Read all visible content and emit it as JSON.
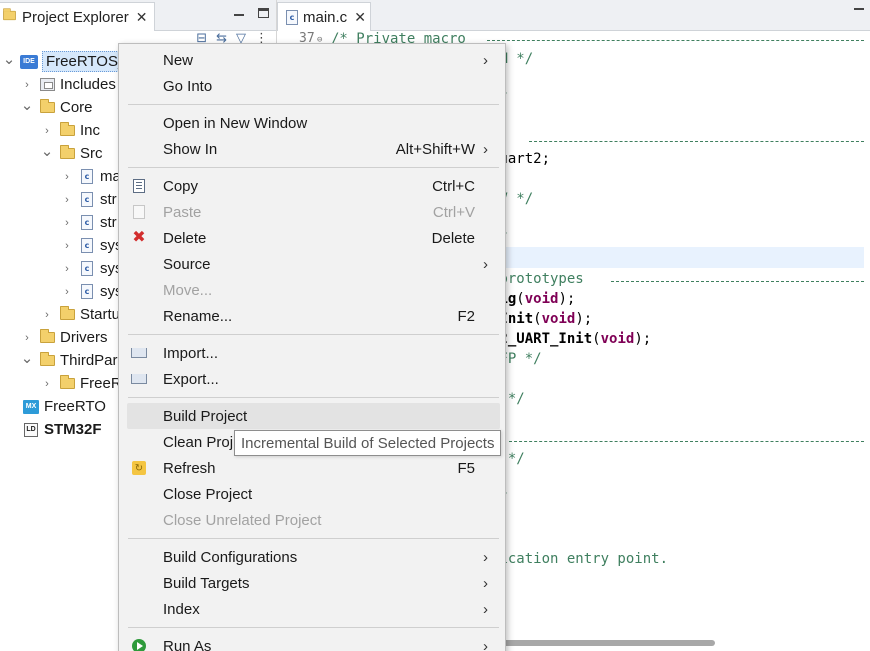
{
  "explorer": {
    "tab_title": "Project Explorer",
    "tree": [
      {
        "label": "FreeRTOS_F",
        "icon": "ide-project-icon",
        "expanded": true
      },
      {
        "label": "Includes",
        "icon": "includes-icon",
        "expanded": false
      },
      {
        "label": "Core",
        "icon": "folder-icon",
        "expanded": true
      },
      {
        "label": "Inc",
        "icon": "folder-icon",
        "expanded": false
      },
      {
        "label": "Src",
        "icon": "folder-icon",
        "expanded": true
      },
      {
        "label": "ma",
        "icon": "c-file-icon"
      },
      {
        "label": "str",
        "icon": "c-file-icon"
      },
      {
        "label": "str",
        "icon": "c-file-icon"
      },
      {
        "label": "sys",
        "icon": "c-file-icon"
      },
      {
        "label": "sys",
        "icon": "c-file-icon"
      },
      {
        "label": "sys",
        "icon": "c-file-icon"
      },
      {
        "label": "Startu",
        "icon": "folder-icon",
        "expanded": false
      },
      {
        "label": "Drivers",
        "icon": "folder-icon",
        "expanded": false
      },
      {
        "label": "ThirdPar",
        "icon": "folder-icon",
        "expanded": true
      },
      {
        "label": "FreeR",
        "icon": "folder-icon",
        "expanded": false
      },
      {
        "label": "FreeRTO",
        "icon": "mx-file-icon"
      },
      {
        "label": "STM32F",
        "icon": "ld-file-icon"
      }
    ]
  },
  "editor": {
    "tab_title": "main.c",
    "line_number": "37",
    "lines": [
      {
        "parts": [
          {
            "t": "/* Private macro ",
            "c": "comment"
          }
        ]
      },
      {
        "parts": [
          {
            "t": "PM */",
            "c": "comment"
          }
        ]
      },
      {
        "parts": [
          {
            "t": "",
            "c": "plain"
          }
        ]
      },
      {
        "parts": [
          {
            "t": "*/",
            "c": "comment"
          }
        ]
      },
      {
        "parts": [
          {
            "t": "",
            "c": "plain"
          }
        ]
      },
      {
        "parts": [
          {
            "t": "s ",
            "c": "comment"
          }
        ]
      },
      {
        "parts": [
          {
            "t": "huart2;",
            "c": "plain"
          }
        ]
      },
      {
        "parts": [
          {
            "t": "",
            "c": "plain"
          }
        ]
      },
      {
        "parts": [
          {
            "t": "PV */",
            "c": "comment"
          }
        ]
      },
      {
        "parts": [
          {
            "t": "",
            "c": "plain"
          }
        ]
      },
      {
        "parts": [
          {
            "t": "*/",
            "c": "comment"
          }
        ]
      },
      {
        "parts": [
          {
            "t": "",
            "c": "plain"
          }
        ]
      },
      {
        "parts": [
          {
            "t": " prototypes ",
            "c": "comment"
          }
        ]
      },
      {
        "parts": [
          {
            "t": "fig",
            "c": "fn"
          },
          {
            "t": "(",
            "c": "plain"
          },
          {
            "t": "void",
            "c": "kw"
          },
          {
            "t": ");",
            "c": "plain"
          }
        ]
      },
      {
        "parts": [
          {
            "t": "_Init",
            "c": "fn"
          },
          {
            "t": "(",
            "c": "plain"
          },
          {
            "t": "void",
            "c": "kw"
          },
          {
            "t": ");",
            "c": "plain"
          }
        ]
      },
      {
        "parts": [
          {
            "t": "T2_UART_Init",
            "c": "fn"
          },
          {
            "t": "(",
            "c": "plain"
          },
          {
            "t": "void",
            "c": "kw"
          },
          {
            "t": ");",
            "c": "plain"
          }
        ]
      },
      {
        "parts": [
          {
            "t": "PFP */",
            "c": "comment"
          }
        ]
      },
      {
        "parts": [
          {
            "t": "",
            "c": "plain"
          }
        ]
      },
      {
        "parts": [
          {
            "t": "P */",
            "c": "comment"
          }
        ]
      },
      {
        "parts": [
          {
            "t": "",
            "c": "plain"
          }
        ]
      },
      {
        "parts": [
          {
            "t": "",
            "c": "plain"
          }
        ]
      },
      {
        "parts": [
          {
            "t": "0 */",
            "c": "comment"
          }
        ]
      },
      {
        "parts": [
          {
            "t": "",
            "c": "plain"
          }
        ]
      },
      {
        "parts": [
          {
            "t": "*/",
            "c": "comment"
          }
        ]
      },
      {
        "parts": [
          {
            "t": "",
            "c": "plain"
          }
        ]
      },
      {
        "parts": [
          {
            "t": "",
            "c": "plain"
          }
        ]
      },
      {
        "parts": [
          {
            "t": "lication entry point.",
            "c": "comment"
          }
        ]
      }
    ]
  },
  "menu": {
    "items": [
      {
        "label": "New",
        "submenu": true
      },
      {
        "label": "Go Into"
      },
      {
        "sep": true
      },
      {
        "label": "Open in New Window"
      },
      {
        "label": "Show In",
        "accel": "Alt+Shift+W",
        "submenu": true
      },
      {
        "sep": true
      },
      {
        "label": "Copy",
        "accel": "Ctrl+C",
        "icon": "copy-icon"
      },
      {
        "label": "Paste",
        "accel": "Ctrl+V",
        "icon": "paste-icon",
        "disabled": true
      },
      {
        "label": "Delete",
        "accel": "Delete",
        "icon": "delete-icon"
      },
      {
        "label": "Source",
        "submenu": true
      },
      {
        "label": "Move...",
        "disabled": true
      },
      {
        "label": "Rename...",
        "accel": "F2"
      },
      {
        "sep": true
      },
      {
        "label": "Import...",
        "icon": "import-icon"
      },
      {
        "label": "Export...",
        "icon": "export-icon"
      },
      {
        "sep": true
      },
      {
        "label": "Build Project",
        "hover": true
      },
      {
        "label": "Clean Proj"
      },
      {
        "label": "Refresh",
        "accel": "F5",
        "icon": "refresh-icon"
      },
      {
        "label": "Close Project"
      },
      {
        "label": "Close Unrelated Project",
        "disabled": true
      },
      {
        "sep": true
      },
      {
        "label": "Build Configurations",
        "submenu": true
      },
      {
        "label": "Build Targets",
        "submenu": true
      },
      {
        "label": "Index",
        "submenu": true
      },
      {
        "sep": true
      },
      {
        "label": "Run As",
        "icon": "run-icon",
        "submenu": true
      }
    ]
  },
  "tooltip": {
    "text": "Incremental Build of Selected Projects"
  }
}
